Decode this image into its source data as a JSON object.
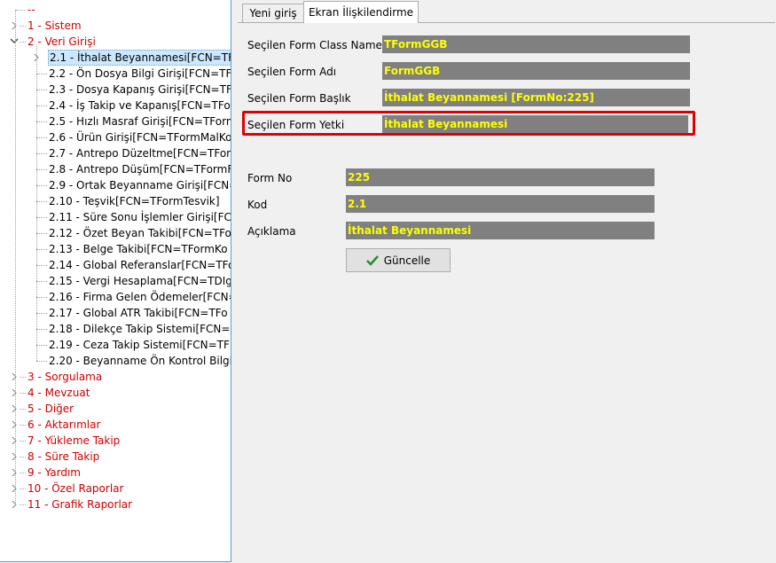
{
  "tree": {
    "root_label": "--",
    "top_items": [
      {
        "label": "1 - Sistem"
      },
      {
        "label": "2 - Veri Girişi"
      }
    ],
    "children": [
      {
        "label": "2.1 - İthalat Beyannamesi[FCN=TFo"
      },
      {
        "label": "2.2 - Ön Dosya Bilgi Girişi[FCN=TF"
      },
      {
        "label": "2.3 - Dosya Kapanış Girişi[FCN=TF"
      },
      {
        "label": "2.4 - İş Takip ve Kapanış[FCN=TFo"
      },
      {
        "label": "2.5 - Hızlı Masraf Girişi[FCN=TForm"
      },
      {
        "label": "2.6 - Ürün Girişi[FCN=TFormMalKo"
      },
      {
        "label": "2.7 - Antrepo Düzeltme[FCN=TForm"
      },
      {
        "label": "2.8 - Antrepo Düşüm[FCN=TFormF"
      },
      {
        "label": "2.9 - Ortak Beyanname Girişi[FCN="
      },
      {
        "label": "2.10 - Teşvik[FCN=TFormTesvik]"
      },
      {
        "label": "2.11 - Süre Sonu İşlemler Girişi[FCN"
      },
      {
        "label": "2.12 - Özet Beyan Takibi[FCN=TFo"
      },
      {
        "label": "2.13 - Belge Takibi[FCN=TFormKo"
      },
      {
        "label": "2.14 - Global Referanslar[FCN=TFo"
      },
      {
        "label": "2.15 - Vergi Hesaplama[FCN=TDIg"
      },
      {
        "label": "2.16 - Firma Gelen Ödemeler[FCN="
      },
      {
        "label": "2.17 - Global ATR Takibi[FCN=TFo"
      },
      {
        "label": "2.18 - Dilekçe Takip Sistemi[FCN="
      },
      {
        "label": "2.19 - Ceza Takip Sistemi[FCN=TF"
      },
      {
        "label": "2.20 - Beyanname Ön Kontrol Bilgil"
      }
    ],
    "bottom_items": [
      {
        "label": "3 - Sorgulama"
      },
      {
        "label": "4 - Mevzuat"
      },
      {
        "label": "5 - Diğer"
      },
      {
        "label": "6 - Aktarımlar"
      },
      {
        "label": "7 - Yükleme Takip"
      },
      {
        "label": "8 - Süre Takip"
      },
      {
        "label": "9 - Yardım"
      },
      {
        "label": "10 - Özel Raporlar"
      },
      {
        "label": "11 - Grafik Raporlar"
      }
    ]
  },
  "tabs": [
    {
      "label": "Yeni giriş"
    },
    {
      "label": "Ekran İlişkilendirme"
    }
  ],
  "form": {
    "class_name_label": "Seçilen Form Class Name",
    "class_name_value": "TFormGGB",
    "form_name_label": "Seçilen Form Adı",
    "form_name_value": "FormGGB",
    "form_title_label": "Seçilen Form Başlık",
    "form_title_value": "İthalat Beyannamesi [FormNo:225]",
    "form_permission_label": "Seçilen Form Yetki",
    "form_permission_value": "İthalat Beyannamesi",
    "form_no_label": "Form No",
    "form_no_value": "225",
    "code_label": "Kod",
    "code_value": "2.1",
    "description_label": "Açıklama",
    "description_value": "İthalat Beyannamesi",
    "update_button_label": "Güncelle"
  },
  "colors": {
    "field_background": "#808080",
    "field_text": "#ffff00",
    "highlight_border": "#e00000",
    "top_level_text": "#cc0000",
    "selection_background": "#cce8ff"
  }
}
